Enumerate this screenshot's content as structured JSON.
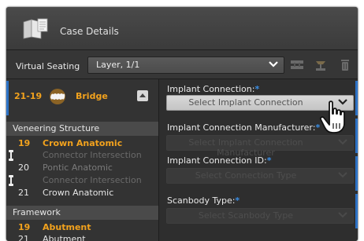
{
  "header": {
    "title": "Case Details",
    "icon": "folder-document-icon"
  },
  "virtual_seating": {
    "label": "Virtual Seating",
    "selected": "Layer, 1/1",
    "tools": [
      "bite-icon",
      "seating-icon",
      "trash-icon"
    ]
  },
  "bridge": {
    "range": "21-19",
    "name": "Bridge",
    "icon": "bridge-teeth-icon"
  },
  "veneering": {
    "title": "Veneering Structure",
    "rows": [
      {
        "number": "19",
        "name": "Crown Anatomic",
        "highlighted": true
      },
      {
        "number": "",
        "name": "Connector Intersection",
        "connector": true
      },
      {
        "number": "20",
        "name": "Pontic Anatomic",
        "dim": true
      },
      {
        "number": "",
        "name": "Connector Intersection",
        "connector": true
      },
      {
        "number": "21",
        "name": "Crown Anatomic"
      }
    ]
  },
  "framework": {
    "title": "Framework",
    "rows": [
      {
        "number": "19",
        "name": "Abutment",
        "highlighted": true
      },
      {
        "number": "21",
        "name": "Abutment"
      }
    ]
  },
  "fields": {
    "implant_connection": {
      "label": "Implant Connection:",
      "value": "Select Implant Connection"
    },
    "manufacturer": {
      "label": "Implant Connection Manufacturer:",
      "value": "Select Implant Connection Manufacturer"
    },
    "connection_id": {
      "label": "Implant Connection ID:",
      "value": "Select Connection Type"
    },
    "scanbody": {
      "label": "Scanbody Type:",
      "value": "Select Scanbody Type"
    }
  },
  "colors": {
    "accent": "#2c72c6",
    "highlight": "#f2a21d",
    "required": "#3a8ee6"
  }
}
